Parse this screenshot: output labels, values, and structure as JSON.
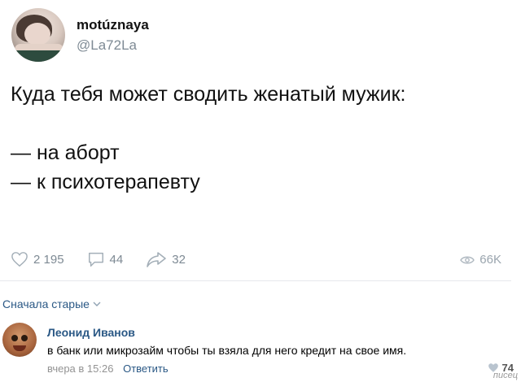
{
  "tweet": {
    "display_name": "motúznaya",
    "handle": "@La72La",
    "text": "Куда тебя может сводить женатый мужик:\n\n— на аборт\n— к психотерапевту",
    "likes": "2 195",
    "replies": "44",
    "retweets": "32",
    "views": "66K"
  },
  "comments_sort": {
    "label": "Сначала старые"
  },
  "comment": {
    "author": "Леонид Иванов",
    "text": "в банк или микрозайм чтобы ты взяла для него кредит на свое имя.",
    "time": "вчера в 15:26",
    "reply_label": "Ответить",
    "likes": "74"
  },
  "watermark": "писец",
  "icons": [
    "heart-icon",
    "comment-icon",
    "share-icon",
    "eye-icon",
    "chevron-down-icon"
  ]
}
